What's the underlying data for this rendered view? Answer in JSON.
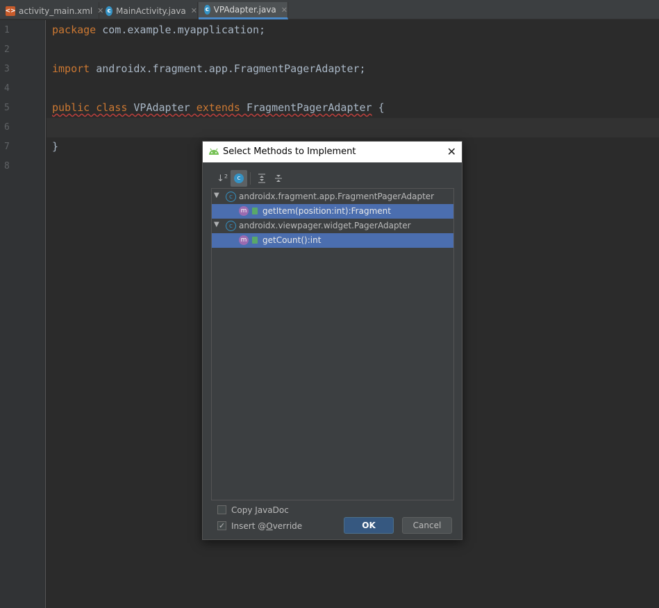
{
  "tabs": [
    {
      "label": "activity_main.xml",
      "icon": "xml-file-icon"
    },
    {
      "label": "MainActivity.java",
      "icon": "class-icon"
    },
    {
      "label": "VPAdapter.java",
      "icon": "class-icon",
      "active": true
    }
  ],
  "editor": {
    "line_numbers": [
      "1",
      "2",
      "3",
      "4",
      "5",
      "6",
      "7",
      "8"
    ],
    "lines": {
      "l1_kw": "package",
      "l1_rest": " com.example.myapplication;",
      "l3_kw": "import",
      "l3_rest": " androidx.fragment.app.FragmentPagerAdapter;",
      "l5_kw1": "public",
      "l5_kw2": "class",
      "l5_name": "VPAdapter",
      "l5_kw3": "extends",
      "l5_super": "FragmentPagerAdapter",
      "l5_brace": " {",
      "l7": "}"
    }
  },
  "dialog": {
    "title": "Select Methods to Implement",
    "toolbar": [
      "sort-icon",
      "class-filter-icon",
      "expand-all-icon",
      "collapse-all-icon"
    ],
    "tree": [
      {
        "label": "androidx.fragment.app.FragmentPagerAdapter"
      },
      {
        "label": "getItem(position:int):Fragment",
        "selected": true
      },
      {
        "label": "androidx.viewpager.widget.PagerAdapter"
      },
      {
        "label": "getCount():int",
        "selected": true
      }
    ],
    "copy_javadoc": {
      "pre": "Copy ",
      "mnemonic": "J",
      "post": "avaDoc",
      "checked": false
    },
    "insert_override": {
      "pre": "Insert @",
      "mnemonic": "O",
      "post": "verride",
      "checked": true
    },
    "ok_label": "OK",
    "cancel_label": "Cancel"
  },
  "colors": {
    "keyword": "#cc7832",
    "selection": "#4b6eaf",
    "accent": "#365880"
  }
}
